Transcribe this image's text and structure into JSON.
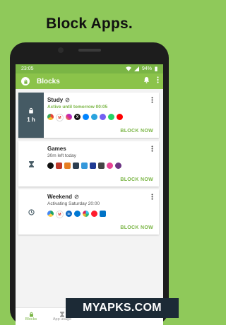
{
  "headline": "Block Apps.",
  "status_bar": {
    "time": "23:05",
    "battery": "94%"
  },
  "app_bar": {
    "title": "Blocks"
  },
  "blocks": [
    {
      "name": "Study",
      "subtitle": "Active until tomorrow 00:05",
      "timer": "1 h",
      "action": "BLOCK NOW",
      "apps": [
        {
          "icon": "chrome-icon",
          "color": "#e8453c",
          "letter": ""
        },
        {
          "icon": "gmail-icon",
          "color": "#ffffff",
          "letter": "M"
        },
        {
          "icon": "instagram-icon",
          "color": "#d6249f",
          "letter": ""
        },
        {
          "icon": "x-icon",
          "color": "#111111",
          "letter": "X"
        },
        {
          "icon": "messenger-icon",
          "color": "#0084ff",
          "letter": ""
        },
        {
          "icon": "telegram-icon",
          "color": "#2aa3de",
          "letter": ""
        },
        {
          "icon": "viber-icon",
          "color": "#7360f2",
          "letter": ""
        },
        {
          "icon": "whatsapp-icon",
          "color": "#25d366",
          "letter": ""
        },
        {
          "icon": "youtube-icon",
          "color": "#ff0000",
          "letter": ""
        }
      ]
    },
    {
      "name": "Games",
      "subtitle": "30m left today",
      "timer": "",
      "action": "BLOCK NOW",
      "apps": [
        {
          "icon": "game-icon-1",
          "color": "#111111",
          "letter": ""
        },
        {
          "icon": "game-icon-2",
          "color": "#c0392b",
          "letter": ""
        },
        {
          "icon": "game-icon-3",
          "color": "#e67e22",
          "letter": ""
        },
        {
          "icon": "game-icon-4",
          "color": "#2c3e50",
          "letter": ""
        },
        {
          "icon": "game-icon-5",
          "color": "#3498db",
          "letter": ""
        },
        {
          "icon": "game-icon-6",
          "color": "#1f3a93",
          "letter": ""
        },
        {
          "icon": "game-icon-7",
          "color": "#444444",
          "letter": ""
        },
        {
          "icon": "game-icon-8",
          "color": "#e84393",
          "letter": ""
        },
        {
          "icon": "game-icon-9",
          "color": "#6c3483",
          "letter": ""
        }
      ]
    },
    {
      "name": "Weekend",
      "subtitle": "Activating Saturday 20:00",
      "timer": "",
      "action": "BLOCK NOW",
      "apps": [
        {
          "icon": "drive-icon",
          "color": "#1fa463",
          "letter": ""
        },
        {
          "icon": "gmail-icon",
          "color": "#ffffff",
          "letter": "M"
        },
        {
          "icon": "linkedin-icon",
          "color": "#0a66c2",
          "letter": "in"
        },
        {
          "icon": "onedrive-icon",
          "color": "#0078d4",
          "letter": ""
        },
        {
          "icon": "slack-icon",
          "color": "#4a154b",
          "letter": ""
        },
        {
          "icon": "opera-icon",
          "color": "#ff1b2d",
          "letter": ""
        },
        {
          "icon": "outlook-icon",
          "color": "#0072c6",
          "letter": ""
        }
      ]
    }
  ],
  "bottom_nav": [
    {
      "label": "Blocks"
    },
    {
      "label": "App usage"
    }
  ],
  "watermark": "MYAPKS.COM"
}
